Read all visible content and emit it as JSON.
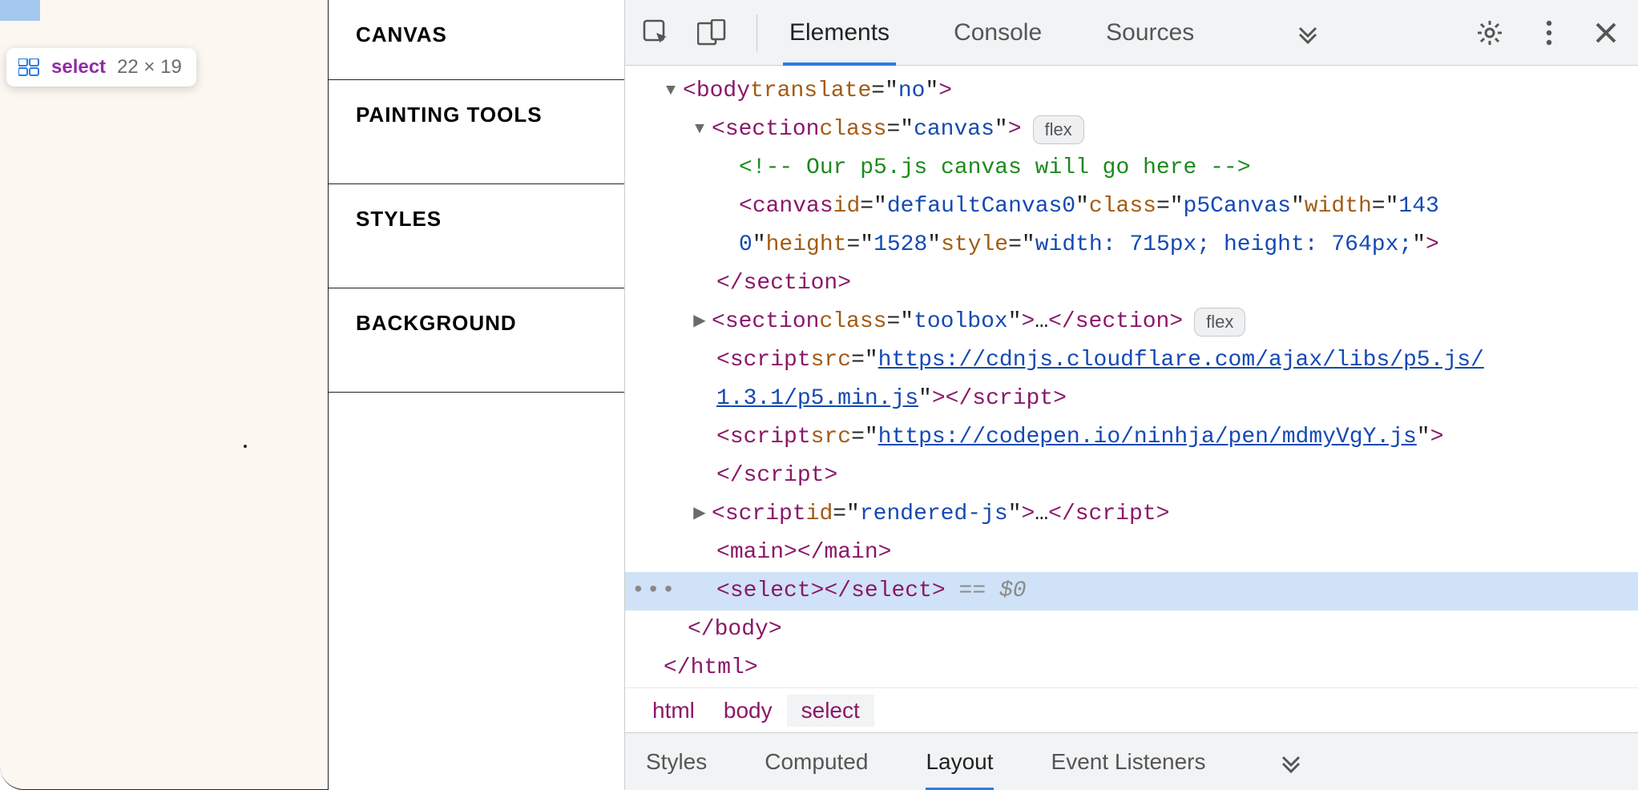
{
  "preview": {
    "tooltip": {
      "tag": "select",
      "dimensions": "22 × 19"
    }
  },
  "toolbox": {
    "items": [
      "CANVAS",
      "PAINTING TOOLS",
      "STYLES",
      "BACKGROUND"
    ]
  },
  "devtools": {
    "tabs": [
      "Elements",
      "Console",
      "Sources"
    ],
    "active_tab": "Elements",
    "breadcrumb": [
      "html",
      "body",
      "select"
    ],
    "active_crumb": "select",
    "bottom_tabs": [
      "Styles",
      "Computed",
      "Layout",
      "Event Listeners"
    ],
    "active_bottom_tab": "Layout",
    "flex_badge": "flex",
    "selected_ref": "$0",
    "eq": "==",
    "ellipsis": "…",
    "tree": {
      "body_open": "<body translate=\"no\">",
      "section_canvas_open": "<section class=\"canvas\">",
      "comment": "<!-- Our p5.js canvas will go here -->",
      "canvas_line1_pre": "<canvas id=\"defaultCanvas0\" class=\"p5Canvas\" width=\"143",
      "canvas_line2": "0\" height=\"1528\" style=\"width: 715px; height: 764px;\">",
      "section_close": "</section>",
      "section_toolbox": "<section class=\"toolbox\">…</section>",
      "script1_pre": "<script src=\"",
      "script1_url": "https://cdnjs.cloudflare.com/ajax/libs/p5.js/1.3.1/p5.min.js",
      "script1_post": "\"></scr__ipt>",
      "script2_pre": "<script src=\"",
      "script2_url": "https://codepen.io/ninhja/pen/mdmyVgY.js",
      "script2_post": "\">",
      "script_close": "</scr__ipt>",
      "script3": "<script id=\"rendered-js\">…</scr__ipt>",
      "main": "<main></main>",
      "select_line": "<select></select>",
      "body_close": "</body>",
      "html_close": "</html>"
    }
  }
}
